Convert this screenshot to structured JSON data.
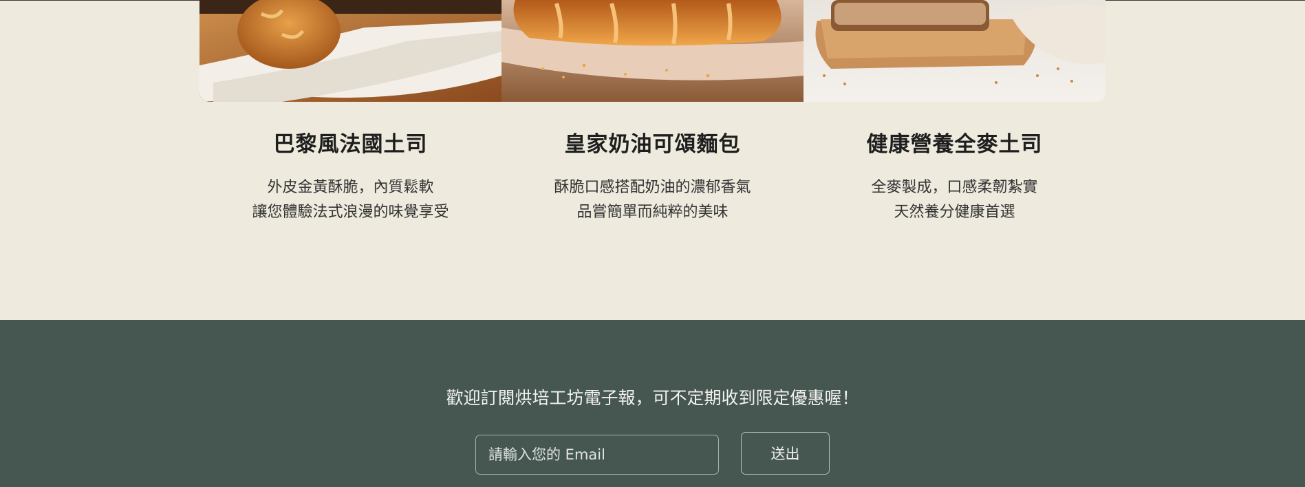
{
  "products": [
    {
      "image": "baguette-on-board-photo",
      "title": "巴黎風法國土司",
      "lines": [
        "外皮金黃酥脆，內質鬆軟",
        "讓您體驗法式浪漫的味覺享受"
      ]
    },
    {
      "image": "croissant-on-cloth-photo",
      "title": "皇家奶油可頌麵包",
      "lines": [
        "酥脆口感搭配奶油的濃郁香氣",
        "品嘗簡單而純粹的美味"
      ]
    },
    {
      "image": "whole-wheat-bread-photo",
      "title": "健康營養全麥土司",
      "lines": [
        "全麥製成，口感柔韌紮實",
        "天然養分健康首選"
      ]
    }
  ],
  "newsletter": {
    "headline": "歡迎訂閱烘培工坊電子報，可不定期收到限定優惠喔！",
    "email_placeholder": "請輸入您的 Email",
    "submit_label": "送出"
  },
  "colors": {
    "page_background": "#eeeadd",
    "footer_background": "#465651"
  }
}
